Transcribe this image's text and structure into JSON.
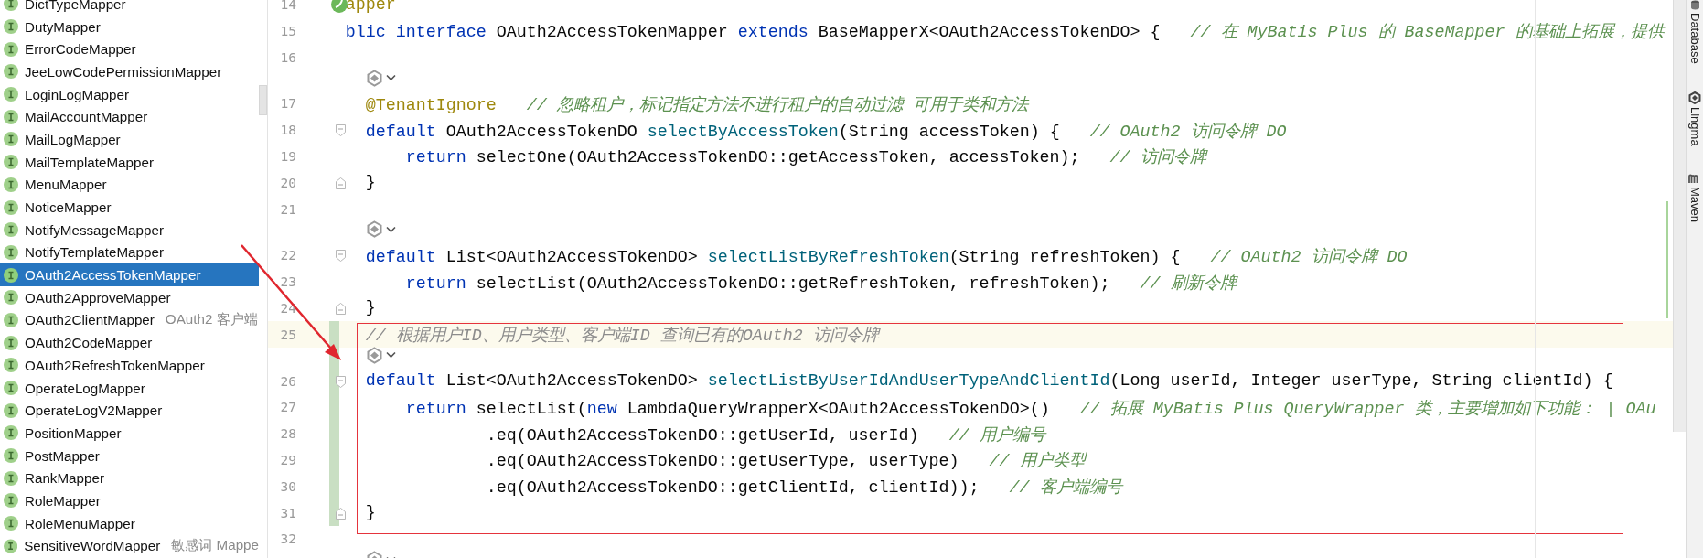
{
  "project_tree": {
    "items": [
      {
        "label": "DictTypeMapper",
        "selected": false
      },
      {
        "label": "DutyMapper",
        "selected": false
      },
      {
        "label": "ErrorCodeMapper",
        "selected": false
      },
      {
        "label": "JeeLowCodePermissionMapper",
        "selected": false
      },
      {
        "label": "LoginLogMapper",
        "selected": false
      },
      {
        "label": "MailAccountMapper",
        "selected": false
      },
      {
        "label": "MailLogMapper",
        "selected": false
      },
      {
        "label": "MailTemplateMapper",
        "selected": false
      },
      {
        "label": "MenuMapper",
        "selected": false
      },
      {
        "label": "NoticeMapper",
        "selected": false
      },
      {
        "label": "NotifyMessageMapper",
        "selected": false
      },
      {
        "label": "NotifyTemplateMapper",
        "selected": false
      },
      {
        "label": "OAuth2AccessTokenMapper",
        "selected": true
      },
      {
        "label": "OAuth2ApproveMapper",
        "selected": false
      },
      {
        "label": "OAuth2ClientMapper",
        "hint": "OAuth2 客户端",
        "selected": false
      },
      {
        "label": "OAuth2CodeMapper",
        "selected": false
      },
      {
        "label": "OAuth2RefreshTokenMapper",
        "selected": false
      },
      {
        "label": "OperateLogMapper",
        "selected": false
      },
      {
        "label": "OperateLogV2Mapper",
        "selected": false
      },
      {
        "label": "PositionMapper",
        "selected": false
      },
      {
        "label": "PostMapper",
        "selected": false
      },
      {
        "label": "RankMapper",
        "selected": false
      },
      {
        "label": "RoleMapper",
        "selected": false
      },
      {
        "label": "RoleMenuMapper",
        "selected": false
      },
      {
        "label": "SensitiveWordMapper",
        "hint": "敏感词 Mappe",
        "selected": false
      }
    ]
  },
  "editor": {
    "lines": [
      {
        "kind": "code",
        "number": "14",
        "bean_marker": true,
        "tokens": [
          {
            "kind": "annotation",
            "text": "apper"
          }
        ]
      },
      {
        "kind": "code",
        "number": "15",
        "tokens": [
          {
            "kind": "keyword",
            "text": "blic interface "
          },
          {
            "kind": "plain",
            "text": "OAuth2AccessTokenMapper "
          },
          {
            "kind": "keyword",
            "text": "extends "
          },
          {
            "kind": "plain",
            "text": "BaseMapperX<OAuth2AccessTokenDO> {   "
          },
          {
            "kind": "comment",
            "text": "// 在 MyBatis Plus 的 BaseMapper 的基础上拓展，提供"
          }
        ]
      },
      {
        "kind": "code",
        "number": "16"
      },
      {
        "kind": "hint"
      },
      {
        "kind": "code",
        "number": "17",
        "tokens": [
          {
            "kind": "annotation",
            "text": "  @TenantIgnore   "
          },
          {
            "kind": "comment",
            "text": "// 忽略租户，标记指定方法不进行租户的自动过滤 可用于类和方法"
          }
        ]
      },
      {
        "kind": "code",
        "number": "18",
        "fold_start": true,
        "tokens": [
          {
            "kind": "keyword",
            "text": "  default "
          },
          {
            "kind": "plain",
            "text": "OAuth2AccessTokenDO "
          },
          {
            "kind": "method",
            "text": "selectByAccessToken"
          },
          {
            "kind": "plain",
            "text": "(String accessToken) {   "
          },
          {
            "kind": "comment",
            "text": "// OAuth2 访问令牌 DO"
          }
        ]
      },
      {
        "kind": "code",
        "number": "19",
        "tokens": [
          {
            "kind": "keyword",
            "text": "      return "
          },
          {
            "kind": "plain",
            "text": "selectOne(OAuth2AccessTokenDO::getAccessToken, accessToken);   "
          },
          {
            "kind": "comment",
            "text": "// 访问令牌"
          }
        ]
      },
      {
        "kind": "code",
        "number": "20",
        "fold_end": true,
        "tokens": [
          {
            "kind": "plain",
            "text": "  }"
          }
        ]
      },
      {
        "kind": "code",
        "number": "21"
      },
      {
        "kind": "hint"
      },
      {
        "kind": "code",
        "number": "22",
        "fold_start": true,
        "tokens": [
          {
            "kind": "keyword",
            "text": "  default "
          },
          {
            "kind": "plain",
            "text": "List<OAuth2AccessTokenDO> "
          },
          {
            "kind": "method",
            "text": "selectListByRefreshToken"
          },
          {
            "kind": "plain",
            "text": "(String refreshToken) {   "
          },
          {
            "kind": "comment",
            "text": "// OAuth2 访问令牌 DO"
          }
        ]
      },
      {
        "kind": "code",
        "number": "23",
        "tokens": [
          {
            "kind": "keyword",
            "text": "      return "
          },
          {
            "kind": "plain",
            "text": "selectList(OAuth2AccessTokenDO::getRefreshToken, refreshToken);   "
          },
          {
            "kind": "comment",
            "text": "// 刷新令牌"
          }
        ]
      },
      {
        "kind": "code",
        "number": "24",
        "fold_end": true,
        "tokens": [
          {
            "kind": "plain",
            "text": "  }"
          }
        ]
      },
      {
        "kind": "group",
        "boxed": true,
        "lines": [
          {
            "kind": "code",
            "number": "25",
            "current": true,
            "changed": true,
            "tokens": [
              {
                "kind": "doc",
                "text": "  // 根据用户ID、用户类型、客户端ID 查询已有的OAuth2 访问令牌"
              }
            ]
          },
          {
            "kind": "hint",
            "changed": true
          },
          {
            "kind": "code",
            "number": "26",
            "fold_start": true,
            "changed": true,
            "tokens": [
              {
                "kind": "keyword",
                "text": "  default "
              },
              {
                "kind": "plain",
                "text": "List<OAuth2AccessTokenDO> "
              },
              {
                "kind": "method",
                "text": "selectListByUserIdAndUserTypeAndClientId"
              },
              {
                "kind": "plain",
                "text": "(Long userId, Integer userType, String clientId) {"
              }
            ]
          },
          {
            "kind": "code",
            "number": "27",
            "changed": true,
            "tokens": [
              {
                "kind": "keyword",
                "text": "      return "
              },
              {
                "kind": "plain",
                "text": "selectList("
              },
              {
                "kind": "keyword",
                "text": "new "
              },
              {
                "kind": "plain",
                "text": "LambdaQueryWrapperX<OAuth2AccessTokenDO>()   "
              },
              {
                "kind": "comment",
                "text": "// 拓展 MyBatis Plus QueryWrapper 类，主要增加如下功能： | OAu"
              }
            ]
          },
          {
            "kind": "code",
            "number": "28",
            "changed": true,
            "tokens": [
              {
                "kind": "plain",
                "text": "              .eq(OAuth2AccessTokenDO::getUserId, userId)   "
              },
              {
                "kind": "comment",
                "text": "// 用户编号"
              }
            ]
          },
          {
            "kind": "code",
            "number": "29",
            "changed": true,
            "tokens": [
              {
                "kind": "plain",
                "text": "              .eq(OAuth2AccessTokenDO::getUserType, userType)   "
              },
              {
                "kind": "comment",
                "text": "// 用户类型"
              }
            ]
          },
          {
            "kind": "code",
            "number": "30",
            "changed": true,
            "tokens": [
              {
                "kind": "plain",
                "text": "              .eq(OAuth2AccessTokenDO::getClientId, clientId));   "
              },
              {
                "kind": "comment",
                "text": "// 客户端编号"
              }
            ]
          },
          {
            "kind": "code",
            "number": "31",
            "fold_end": true,
            "changed": true,
            "tokens": [
              {
                "kind": "plain",
                "text": "  }"
              }
            ]
          }
        ]
      },
      {
        "kind": "code",
        "number": "32"
      },
      {
        "kind": "hint"
      }
    ]
  },
  "tool_strip": [
    {
      "label": "Database"
    },
    {
      "label": "Lingma"
    },
    {
      "label": "Maven"
    }
  ]
}
